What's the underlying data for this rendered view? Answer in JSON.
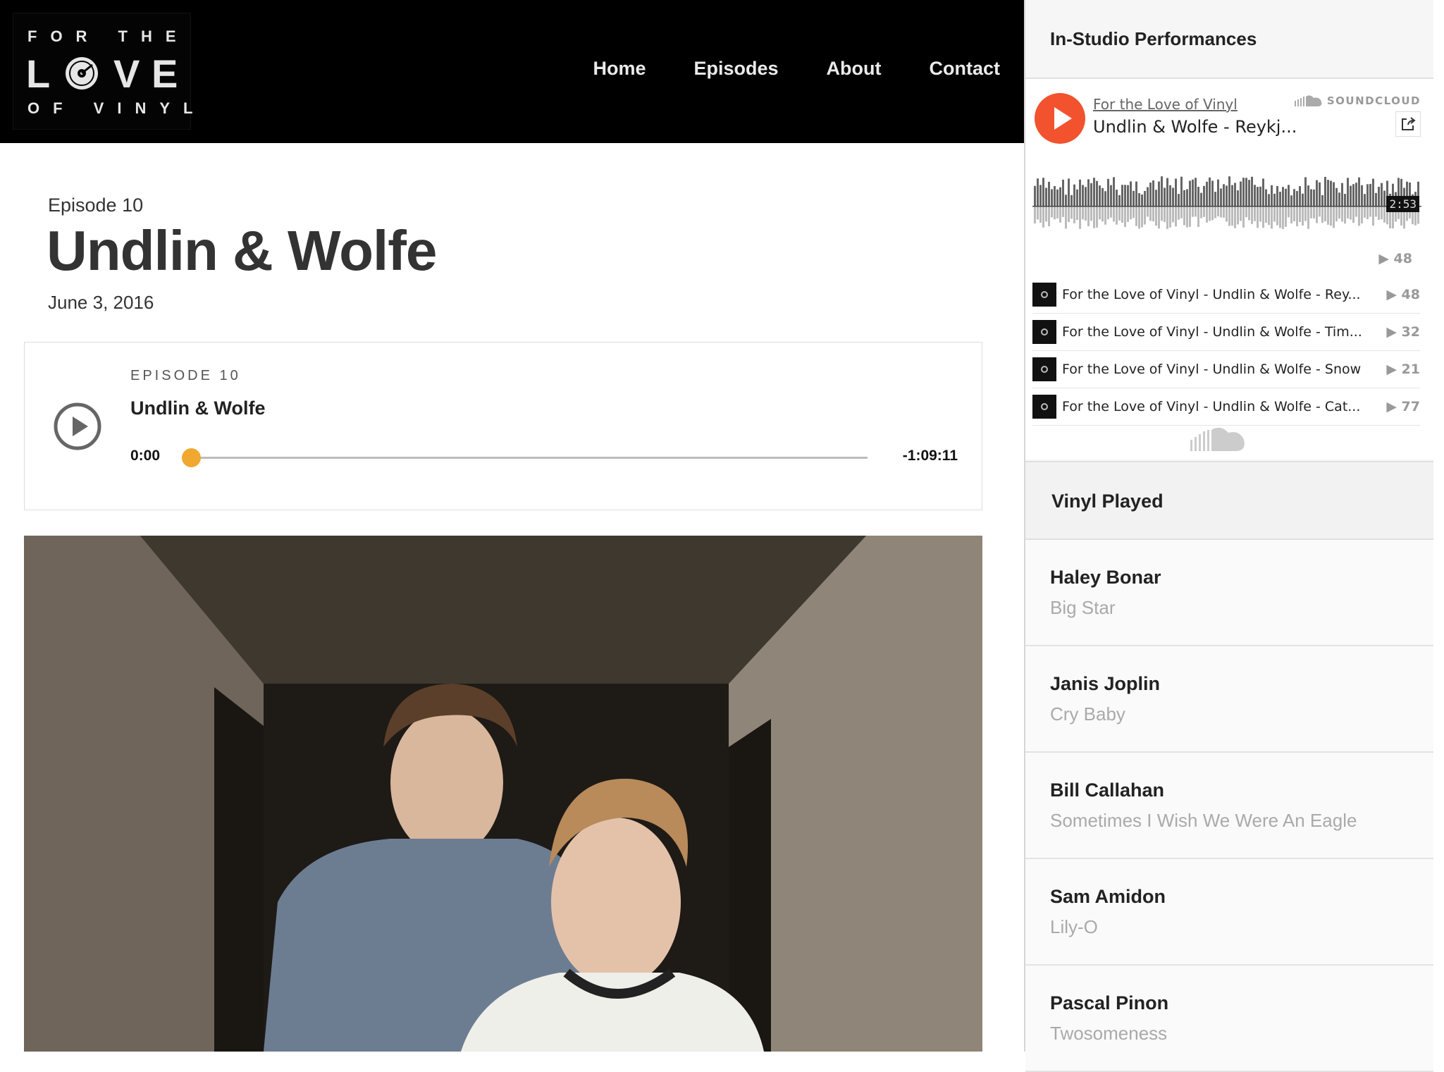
{
  "header": {
    "logo": {
      "line1": "FOR THE",
      "love_l": "L",
      "love_v": "V",
      "love_e": "E",
      "line3": "OF VINYL"
    },
    "nav": [
      "Home",
      "Episodes",
      "About",
      "Contact"
    ]
  },
  "episode": {
    "label": "Episode 10",
    "title": "Undlin & Wolfe",
    "date": "June 3, 2016"
  },
  "player": {
    "episode_label": "EPISODE 10",
    "title": "Undlin & Wolfe",
    "current_time": "0:00",
    "remaining_time": "-1:09:11",
    "progress": 0,
    "accent": "#f0a830"
  },
  "sidebar": {
    "performances_title": "In-Studio Performances",
    "soundcloud": {
      "user": "For the Love of Vinyl",
      "track": "Undlin & Wolfe - Reykj...",
      "brand": "SOUNDCLOUD",
      "duration": "2:53",
      "plays": "▶ 48",
      "accent": "#ff5500",
      "tracks": [
        {
          "title": "For the Love of Vinyl - Undlin & Wolfe - Rey...",
          "plays": "▶ 48"
        },
        {
          "title": "For the Love of Vinyl - Undlin & Wolfe - Tim...",
          "plays": "▶ 32"
        },
        {
          "title": "For the Love of Vinyl - Undlin & Wolfe - Snow",
          "plays": "▶ 21"
        },
        {
          "title": "For the Love of Vinyl - Undlin & Wolfe - Cat...",
          "plays": "▶ 77"
        }
      ]
    },
    "vinyl_title": "Vinyl Played",
    "vinyl": [
      {
        "artist": "Haley Bonar",
        "song": "Big Star"
      },
      {
        "artist": "Janis Joplin",
        "song": "Cry Baby"
      },
      {
        "artist": "Bill Callahan",
        "song": "Sometimes I Wish We Were An Eagle"
      },
      {
        "artist": "Sam Amidon",
        "song": "Lily-O"
      },
      {
        "artist": "Pascal Pinon",
        "song": "Twosomeness"
      }
    ]
  }
}
